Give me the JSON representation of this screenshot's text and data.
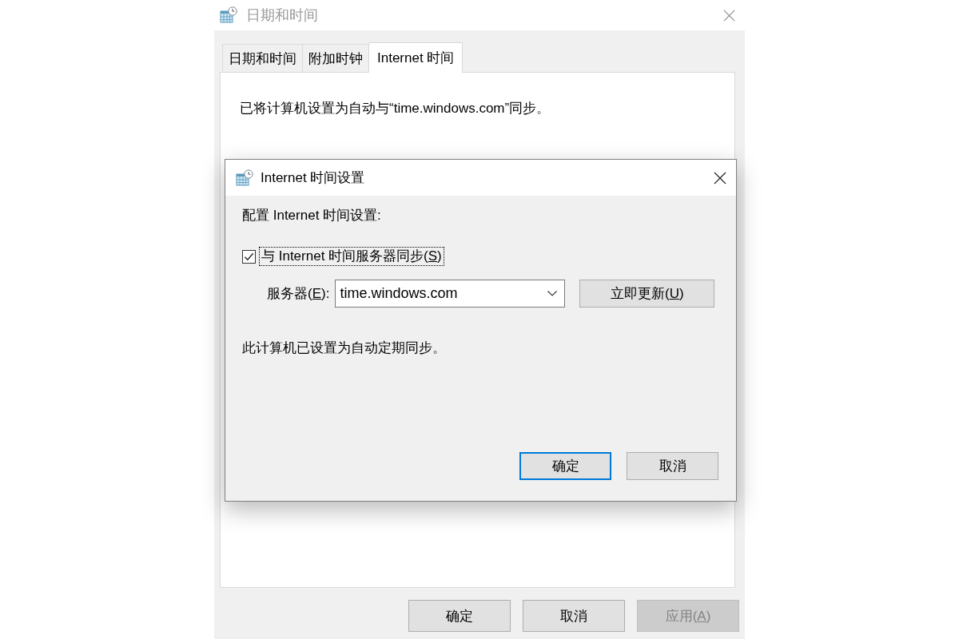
{
  "window": {
    "title": "日期和时间",
    "active": false
  },
  "tabs": [
    {
      "label": "日期和时间",
      "selected": false
    },
    {
      "label": "附加时钟",
      "selected": false
    },
    {
      "label": "Internet 时间",
      "selected": true
    }
  ],
  "panel": {
    "status_text": "已将计算机设置为自动与“time.windows.com”同步。"
  },
  "buttons": [
    {
      "label": "确定",
      "disabled": false
    },
    {
      "label": "取消",
      "disabled": false
    },
    {
      "label": "应用(",
      "access_key": "A",
      "label_end": ")",
      "disabled": true
    }
  ],
  "dialog": {
    "title": "Internet 时间设置",
    "active": true,
    "heading": "配置 Internet 时间设置:",
    "sync_checkbox": {
      "label": "与 Internet 时间服务器同步(",
      "access_key": "S",
      "label_end": ")",
      "checked": true,
      "focused": true
    },
    "server": {
      "label": "服务器(",
      "access_key": "E",
      "label_end": "):",
      "value": "time.windows.com"
    },
    "update_button": {
      "label": "立即更新(",
      "access_key": "U",
      "label_end": ")"
    },
    "status_text": "此计算机已设置为自动定期同步。",
    "buttons": [
      {
        "label": "确定",
        "default": true
      },
      {
        "label": "取消",
        "default": false
      }
    ]
  }
}
